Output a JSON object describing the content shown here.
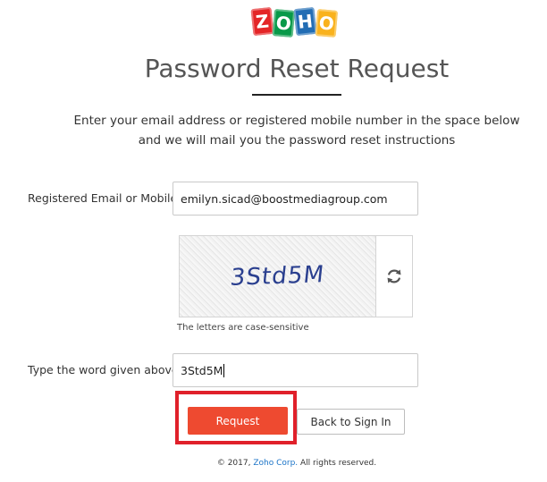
{
  "logo": {
    "letters": [
      "Z",
      "O",
      "H",
      "O"
    ],
    "colors": [
      "#e42527",
      "#089949",
      "#226db4",
      "#f9b21d"
    ]
  },
  "page": {
    "title": "Password Reset Request",
    "instructions_line1": "Enter your email address or registered mobile number in the space below",
    "instructions_line2": "and we will mail you the password reset instructions"
  },
  "form": {
    "email_label": "Registered Email or Mobile",
    "email_value": "emilyn.sicad@boostmediagroup.com",
    "captcha_text": "3Std5M",
    "captcha_hint": "The letters are case-sensitive",
    "captcha_refresh_icon": "refresh-icon",
    "word_label": "Type the word given above",
    "word_value": "3Std5M"
  },
  "buttons": {
    "request_label": "Request",
    "back_label": "Back to Sign In",
    "request_color": "#ee4a30",
    "highlight_color": "#e0202a"
  },
  "footer": {
    "prefix": "© 2017, ",
    "link": "Zoho Corp.",
    "suffix": " All rights reserved."
  }
}
